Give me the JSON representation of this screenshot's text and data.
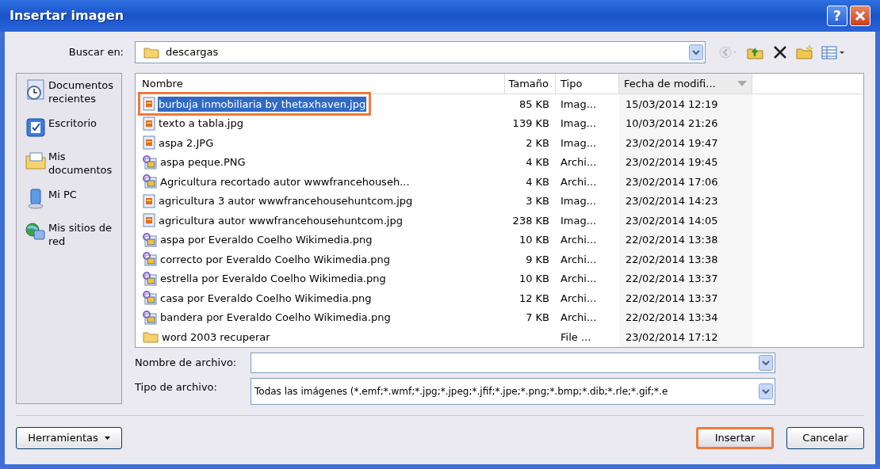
{
  "window": {
    "title": "Insertar imagen",
    "title_buttons": [
      {
        "kind": "help",
        "label": "?"
      },
      {
        "kind": "close"
      }
    ]
  },
  "look_in": {
    "label": "Buscar en:",
    "value": "descargas"
  },
  "toolbar": [
    {
      "kind": "back",
      "disabled": true
    },
    {
      "kind": "up",
      "disabled": false
    },
    {
      "kind": "delete",
      "disabled": false
    },
    {
      "kind": "new-folder",
      "disabled": false
    },
    {
      "kind": "views",
      "disabled": false
    }
  ],
  "places": [
    {
      "kind": "recent",
      "label": "Documentos recientes"
    },
    {
      "kind": "desktop",
      "label": "Escritorio"
    },
    {
      "kind": "documents",
      "label": "Mis documentos"
    },
    {
      "kind": "computer",
      "label": "Mi PC"
    },
    {
      "kind": "network",
      "label": "Mis sitios de red"
    }
  ],
  "table": {
    "columns": [
      {
        "label": "Nombre",
        "sorted": false
      },
      {
        "label": "Tamaño",
        "sorted": false
      },
      {
        "label": "Tipo",
        "sorted": false
      },
      {
        "label": "Fecha de modifi...",
        "sorted": true
      }
    ],
    "rows": [
      {
        "kind": "jpg",
        "name": "burbuja inmobiliaria by thetaxhaven.jpg",
        "size": "85 KB",
        "type": "Imag...",
        "date": "15/03/2014 12:19",
        "selected": true,
        "highlighted": true
      },
      {
        "kind": "jpg",
        "name": "texto a tabla.jpg",
        "size": "139 KB",
        "type": "Imag...",
        "date": "10/03/2014 21:26",
        "selected": false,
        "highlighted": false
      },
      {
        "kind": "jpg",
        "name": "aspa 2.JPG",
        "size": "2 KB",
        "type": "Imag...",
        "date": "23/02/2014 19:47",
        "selected": false,
        "highlighted": false
      },
      {
        "kind": "png",
        "name": "aspa peque.PNG",
        "size": "4 KB",
        "type": "Archi...",
        "date": "23/02/2014 19:45",
        "selected": false,
        "highlighted": false
      },
      {
        "kind": "png",
        "name": "Agricultura recortado autor wwwfrancehouseh...",
        "size": "4 KB",
        "type": "Archi...",
        "date": "23/02/2014 17:06",
        "selected": false,
        "highlighted": false
      },
      {
        "kind": "jpg",
        "name": "agricultura 3 autor wwwfrancehousehuntcom.jpg",
        "size": "3 KB",
        "type": "Imag...",
        "date": "23/02/2014 14:23",
        "selected": false,
        "highlighted": false
      },
      {
        "kind": "jpg",
        "name": "agricultura autor wwwfrancehousehuntcom.jpg",
        "size": "238 KB",
        "type": "Imag...",
        "date": "23/02/2014 14:05",
        "selected": false,
        "highlighted": false
      },
      {
        "kind": "png",
        "name": "aspa por Everaldo Coelho Wikimedia.png",
        "size": "10 KB",
        "type": "Archi...",
        "date": "22/02/2014 13:38",
        "selected": false,
        "highlighted": false
      },
      {
        "kind": "png",
        "name": "correcto por Everaldo Coelho Wikimedia.png",
        "size": "9 KB",
        "type": "Archi...",
        "date": "22/02/2014 13:38",
        "selected": false,
        "highlighted": false
      },
      {
        "kind": "png",
        "name": "estrella por Everaldo Coelho Wikimedia.png",
        "size": "10 KB",
        "type": "Archi...",
        "date": "22/02/2014 13:37",
        "selected": false,
        "highlighted": false
      },
      {
        "kind": "png",
        "name": "casa por Everaldo Coelho Wikimedia.png",
        "size": "12 KB",
        "type": "Archi...",
        "date": "22/02/2014 13:37",
        "selected": false,
        "highlighted": false
      },
      {
        "kind": "png",
        "name": "bandera por Everaldo Coelho Wikimedia.png",
        "size": "7 KB",
        "type": "Archi...",
        "date": "22/02/2014 13:34",
        "selected": false,
        "highlighted": false
      },
      {
        "kind": "folder",
        "name": "word 2003 recuperar",
        "type": "File ...",
        "date": "23/02/2014 17:12",
        "selected": false,
        "highlighted": false
      }
    ]
  },
  "file_name": {
    "label": "Nombre de archivo:"
  },
  "file_type": {
    "label": "Tipo de archivo:",
    "value": "Todas las imágenes (*.emf;*.wmf;*.jpg;*.jpeg;*.jfif;*.jpe;*.png;*.bmp;*.dib;*.rle;*.gif;*.e"
  },
  "buttons": [
    {
      "kind": "menu",
      "label": "Herramientas",
      "highlighted": false
    },
    {
      "kind": "primary",
      "label": "Insertar",
      "highlighted": true
    },
    {
      "kind": "cancel",
      "label": "Cancelar",
      "highlighted": false
    }
  ]
}
